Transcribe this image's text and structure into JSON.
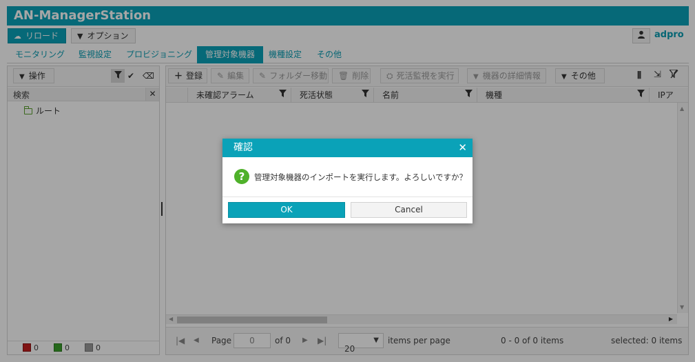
{
  "app": {
    "title": "AN-ManagerStation"
  },
  "toolbar": {
    "reload_label": "リロード",
    "options_label": "オプション",
    "username": "adpro"
  },
  "tabs": [
    {
      "label": "モニタリング",
      "active": false
    },
    {
      "label": "監視設定",
      "active": false
    },
    {
      "label": "プロビジョニング",
      "active": false
    },
    {
      "label": "管理対象機器",
      "active": true
    },
    {
      "label": "機種設定",
      "active": false
    },
    {
      "label": "その他",
      "active": false
    }
  ],
  "left_panel": {
    "operations_label": "操作",
    "search_label": "検索",
    "tree_root": "ルート",
    "status_counts": [
      "0",
      "0",
      "0"
    ]
  },
  "right_toolbar": {
    "register": "登録",
    "edit": "編集",
    "folder_move": "フォルダー移動",
    "delete": "削除",
    "run_liveness": "死活監視を実行",
    "device_details": "機器の詳細情報",
    "other": "その他"
  },
  "grid": {
    "columns": [
      "未確認アラーム",
      "死活状態",
      "名前",
      "機種",
      "IPア"
    ]
  },
  "pager": {
    "page_label": "Page",
    "page_value": "0",
    "of_label": "of 0",
    "page_size": "20",
    "items_per_page": "items per page",
    "range": "0 - 0 of 0 items",
    "selected": "selected: 0 items"
  },
  "dialog": {
    "title": "確認",
    "message": "管理対象機器のインポートを実行します。よろしいですか？",
    "ok_label": "OK",
    "cancel_label": "Cancel"
  },
  "colors": {
    "accent": "#0aa2b8",
    "question_icon": "#4fb12a"
  }
}
